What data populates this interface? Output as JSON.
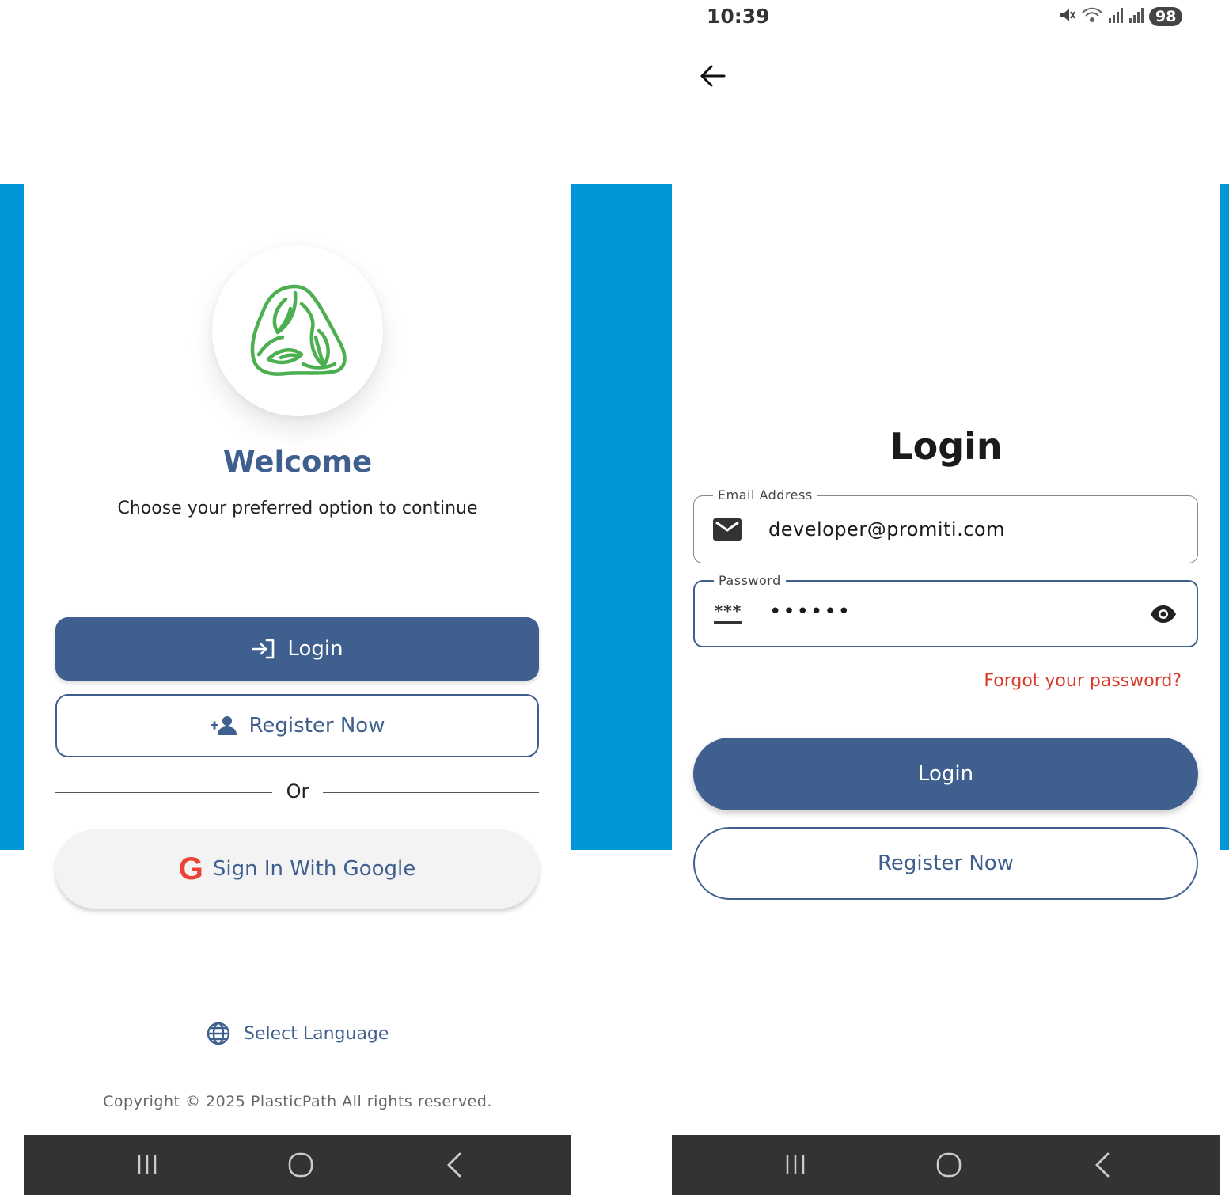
{
  "colors": {
    "primary": "#3f5f8f",
    "accent_band": "#0097d9",
    "error": "#d93a2b",
    "logo_green": "#4caf50",
    "nav_bar": "#333333"
  },
  "left": {
    "title": "Welcome",
    "subtitle": "Choose your preferred option to continue",
    "login_label": "Login",
    "register_label": "Register Now",
    "or_label": "Or",
    "google_label": "Sign In With Google",
    "google_icon_text": "G",
    "language_label": "Select Language",
    "copyright": "Copyright © 2025 PlasticPath All rights reserved.",
    "icons": [
      "recycle-leaf-logo",
      "login-icon",
      "person-add-icon",
      "google-icon",
      "globe-icon"
    ]
  },
  "right": {
    "status_bar": {
      "time": "10:39",
      "battery": "98"
    },
    "title": "Login",
    "email": {
      "label": "Email Address",
      "value": "developer@promiti.com"
    },
    "password": {
      "label": "Password",
      "value": "••••••",
      "icon_text": "***"
    },
    "forgot_label": "Forgot your password?",
    "login_label": "Login",
    "register_label": "Register Now",
    "icons": [
      "back-arrow-icon",
      "mail-icon",
      "password-icon",
      "eye-icon"
    ]
  },
  "nav_bar": {
    "icons": [
      "recents-icon",
      "home-icon",
      "back-icon"
    ]
  }
}
